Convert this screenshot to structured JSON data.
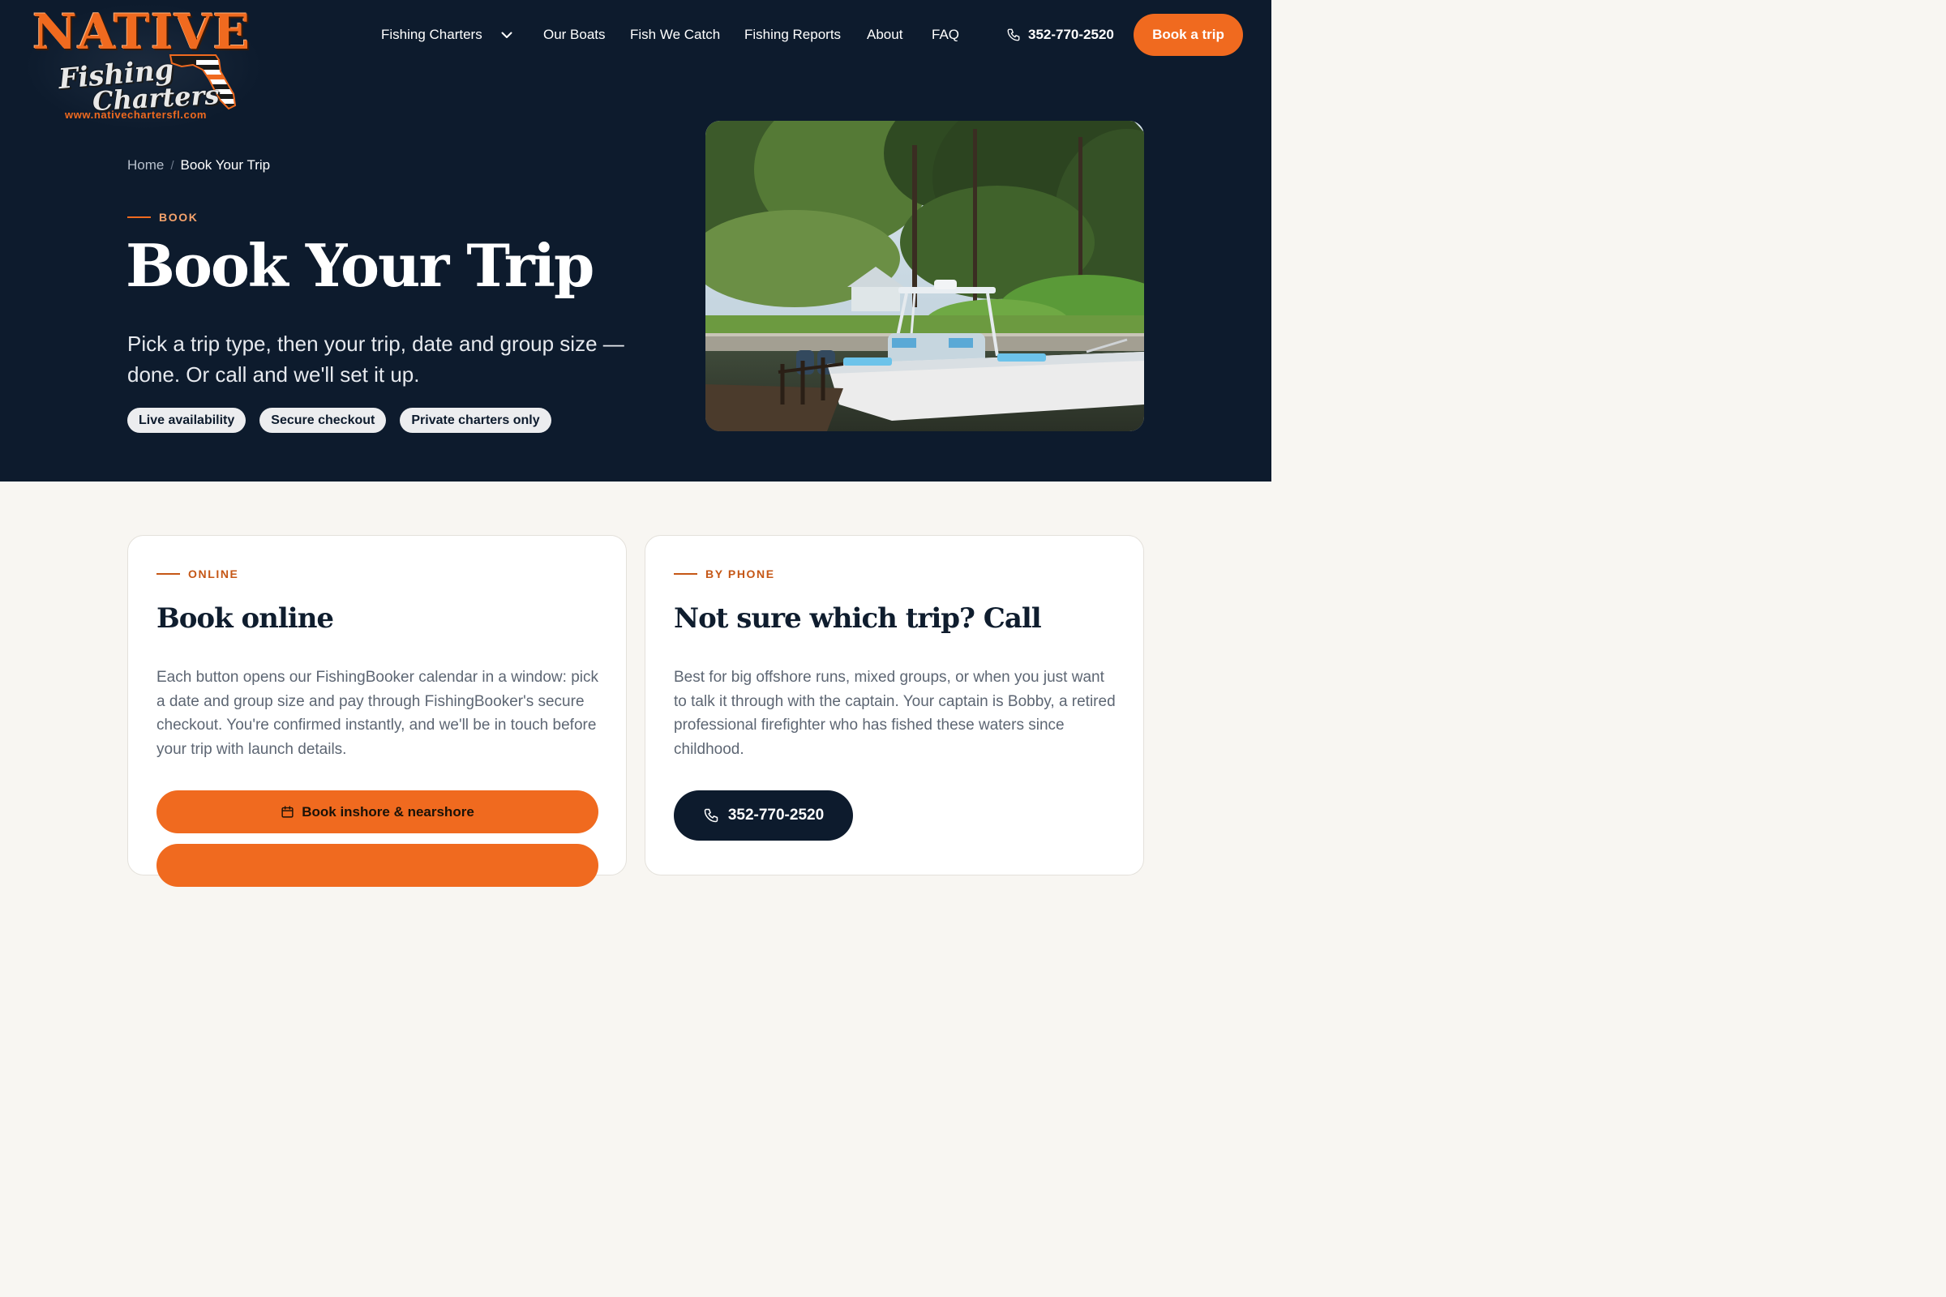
{
  "brand": {
    "logo_title": "NATIVE",
    "logo_line1": "Fishing",
    "logo_line2": "Charters",
    "logo_url": "www.nativechartersfl.com"
  },
  "nav": {
    "items": [
      "Fishing Charters",
      "Our Boats",
      "Fish We Catch",
      "Fishing Reports",
      "About",
      "FAQ"
    ],
    "phone": "352-770-2520",
    "cta": "Book a trip"
  },
  "breadcrumb": {
    "home": "Home",
    "sep": "/",
    "current": "Book Your Trip"
  },
  "hero": {
    "eyebrow": "BOOK",
    "title": "Book Your Trip",
    "subtitle": "Pick a trip type, then your trip, date and group size — done. Or call and we'll set it up.",
    "pills": [
      "Live availability",
      "Secure checkout",
      "Private charters only"
    ]
  },
  "cards": {
    "online": {
      "eyebrow": "ONLINE",
      "title": "Book online",
      "text": "Each button opens our FishingBooker calendar in a window: pick a date and group size and pay through FishingBooker's secure checkout. You're confirmed instantly, and we'll be in touch before your trip with launch details.",
      "button": "Book inshore & nearshore"
    },
    "phone": {
      "eyebrow": "BY PHONE",
      "title": "Not sure which trip? Call",
      "text": "Best for big offshore runs, mixed groups, or when you just want to talk it through with the captain. Your captain is Bobby, a retired professional firefighter who has fished these waters since childhood.",
      "button": "352-770-2520"
    }
  },
  "colors": {
    "navy": "#0d1b2d",
    "orange": "#f06a1f",
    "cream": "#f8f6f2"
  },
  "icons": [
    "chevron-down-icon",
    "phone-icon",
    "calendar-icon"
  ]
}
